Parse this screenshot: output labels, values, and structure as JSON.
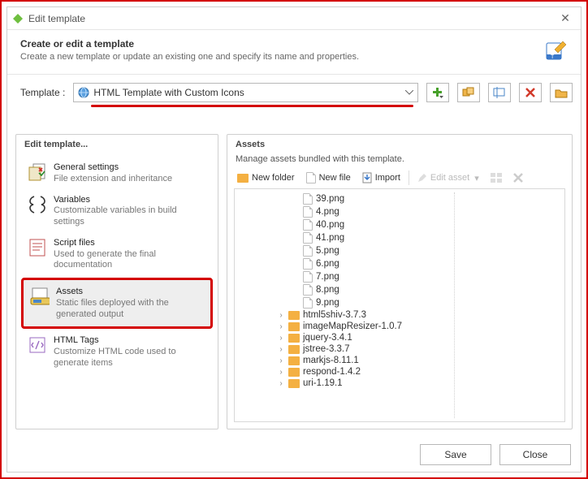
{
  "dialog": {
    "title": "Edit template"
  },
  "header": {
    "title": "Create or edit a template",
    "subtitle": "Create a new template or update an existing one and specify its name and properties."
  },
  "templateRow": {
    "label": "Template :",
    "selected": "HTML Template with Custom Icons"
  },
  "leftPanel": {
    "title": "Edit template...",
    "items": [
      {
        "title": "General settings",
        "sub": "File extension and inheritance"
      },
      {
        "title": "Variables",
        "sub": "Customizable variables in build settings"
      },
      {
        "title": "Script files",
        "sub": "Used to generate the final documentation"
      },
      {
        "title": "Assets",
        "sub": "Static files deployed with the generated output"
      },
      {
        "title": "HTML Tags",
        "sub": "Customize HTML code used to generate items"
      }
    ],
    "selectedIndex": 3
  },
  "rightPanel": {
    "title": "Assets",
    "subtitle": "Manage assets bundled with this template.",
    "toolbar": {
      "newFolder": "New folder",
      "newFile": "New file",
      "import": "Import",
      "editAsset": "Edit asset"
    },
    "files": [
      "39.png",
      "4.png",
      "40.png",
      "41.png",
      "5.png",
      "6.png",
      "7.png",
      "8.png",
      "9.png"
    ],
    "folders": [
      "html5shiv-3.7.3",
      "imageMapResizer-1.0.7",
      "jquery-3.4.1",
      "jstree-3.3.7",
      "markjs-8.11.1",
      "respond-1.4.2",
      "uri-1.19.1"
    ]
  },
  "footer": {
    "save": "Save",
    "close": "Close"
  }
}
